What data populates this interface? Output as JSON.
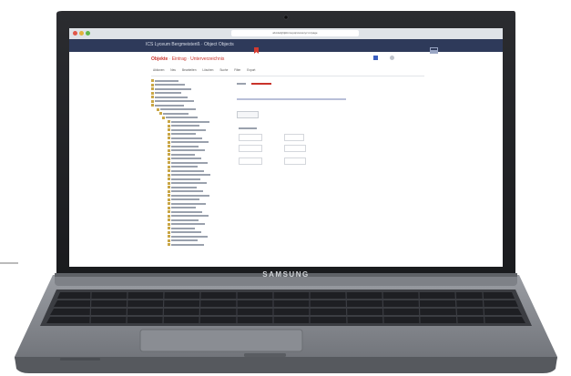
{
  "browser": {
    "url": "abcdefghijklmnopqrstuvwxyz.ru/page"
  },
  "app": {
    "title": "ICS Lyceum Bergmeisteriß · Object Objects"
  },
  "breadcrumb": {
    "root": "Objekte",
    "mid": "Eintrag",
    "current": "Unterverzeichnis"
  },
  "toolbar": {
    "items": [
      "Aktionen",
      "Neu",
      "Bearbeiten",
      "Löschen",
      "Suche",
      "Filter",
      "Export"
    ]
  },
  "device": {
    "brand": "SAMSUNG"
  },
  "colors": {
    "accent": "#c9332b",
    "header": "#2e3a5a",
    "folder": "#c9a646"
  }
}
